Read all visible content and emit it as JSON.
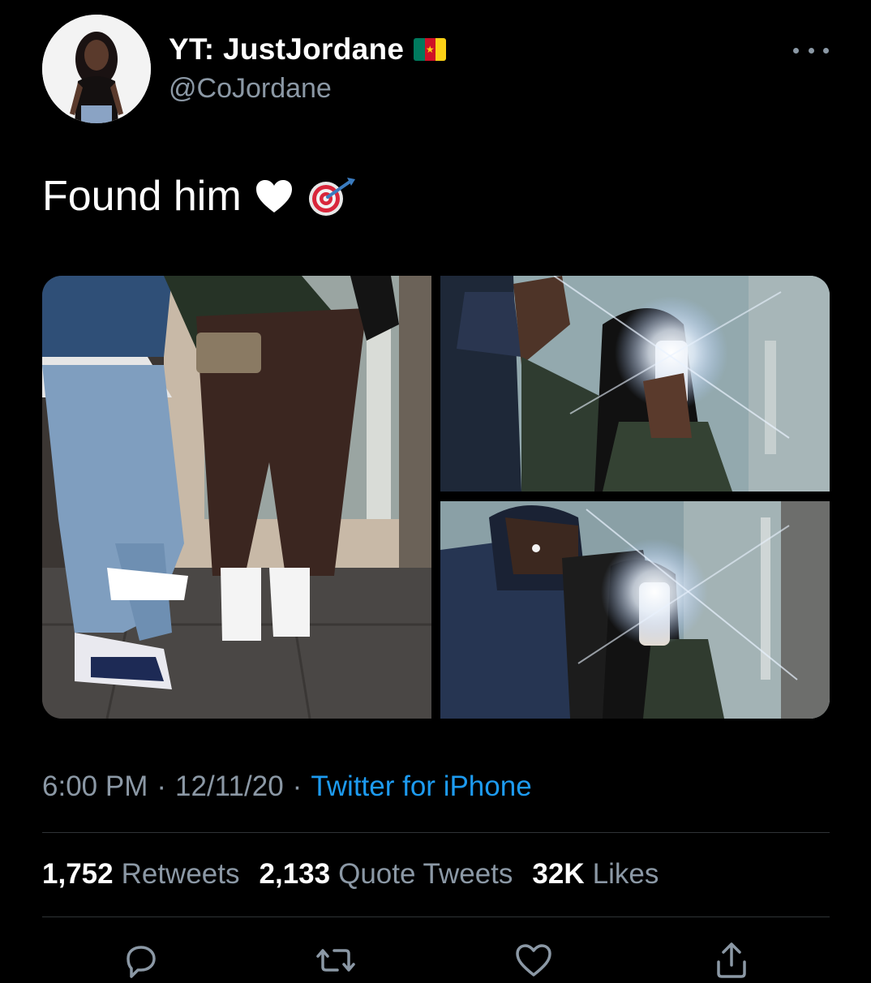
{
  "author": {
    "display_name": "YT: JustJordane",
    "handle": "@CoJordane",
    "flag_icon": "cameroon-flag-icon",
    "flag_colors": [
      "#007a5e",
      "#ce1126",
      "#fcd116"
    ]
  },
  "tweet": {
    "text": "Found him",
    "emojis": [
      "white-heart-icon",
      "direct-hit-icon"
    ]
  },
  "media": {
    "photos": [
      "mirror-photo-couple-full-body",
      "mirror-selfie-waving",
      "mirror-selfie-covering-face"
    ]
  },
  "meta": {
    "time": "6:00 PM",
    "separator": "·",
    "date": "12/11/20",
    "source": "Twitter for iPhone"
  },
  "stats": {
    "retweets_count": "1,752",
    "retweets_label": "Retweets",
    "quotes_count": "2,133",
    "quotes_label": "Quote Tweets",
    "likes_count": "32K",
    "likes_label": "Likes"
  },
  "actions": [
    "reply-icon",
    "retweet-icon",
    "like-icon",
    "share-icon"
  ],
  "colors": {
    "background": "#000000",
    "primary_text": "#ffffff",
    "secondary_text": "#8b98a5",
    "link": "#1d9bf0",
    "divider": "#2f3336"
  }
}
